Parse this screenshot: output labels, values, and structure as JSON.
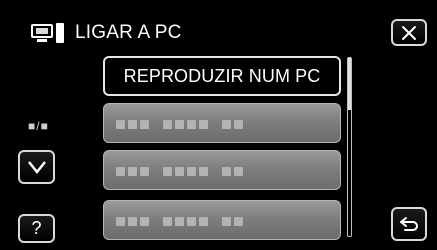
{
  "header": {
    "title": "LIGAR A PC",
    "icon": "pc-icon"
  },
  "close_button": {
    "icon": "close-icon"
  },
  "menu": {
    "items": [
      {
        "label": "REPRODUZIR NUM PC",
        "active": true
      },
      {
        "label": "",
        "active": false
      },
      {
        "label": "",
        "active": false
      },
      {
        "label": "",
        "active": false
      }
    ]
  },
  "controls": {
    "page_indicator": "■/■",
    "down_icon": "chevron-down-icon",
    "help_label": "?",
    "back_icon": "return-icon"
  },
  "colors": {
    "background": "#000000",
    "item_gray": "#808080",
    "text": "#ffffff",
    "border": "#d9d9d9"
  }
}
